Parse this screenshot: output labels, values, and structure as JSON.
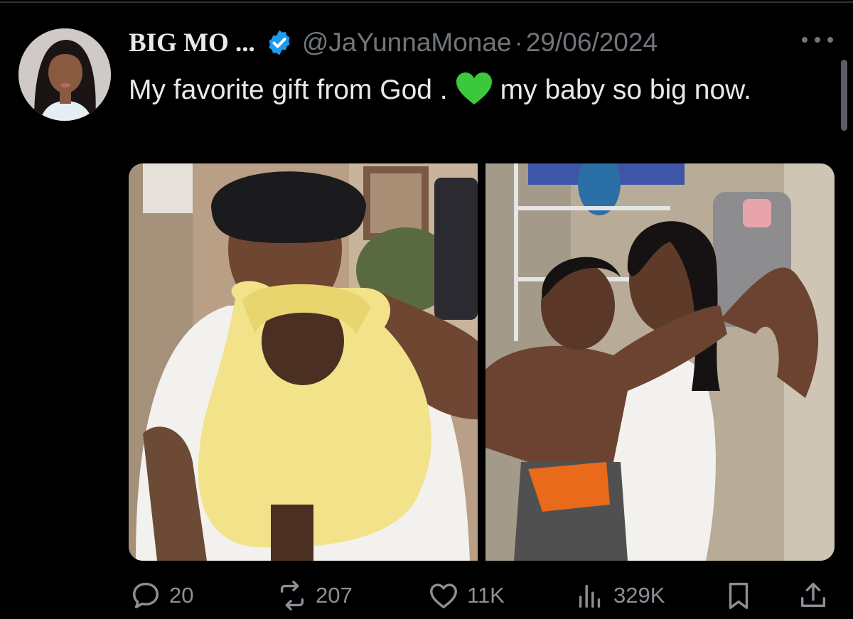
{
  "tweet": {
    "display_name": "BIG MO ...",
    "handle": "@JaYunnaMonae",
    "separator": "·",
    "date": "29/06/2024",
    "text_part1": "My favorite gift from God .",
    "emoji": "green-heart",
    "text_part2": "my baby so big now.",
    "media": [
      {
        "description": "Mirror selfie: woman in black bonnet holding baby in yellow robe"
      },
      {
        "description": "Mirror selfie: woman in white tank top holding young boy"
      }
    ]
  },
  "actions": {
    "replies": "20",
    "retweets": "207",
    "likes": "11K",
    "views": "329K"
  },
  "colors": {
    "background": "#000000",
    "text": "#e7e9ea",
    "secondary": "#71767b",
    "verified": "#1d9bf0",
    "emoji_heart": "#3cc83c"
  }
}
